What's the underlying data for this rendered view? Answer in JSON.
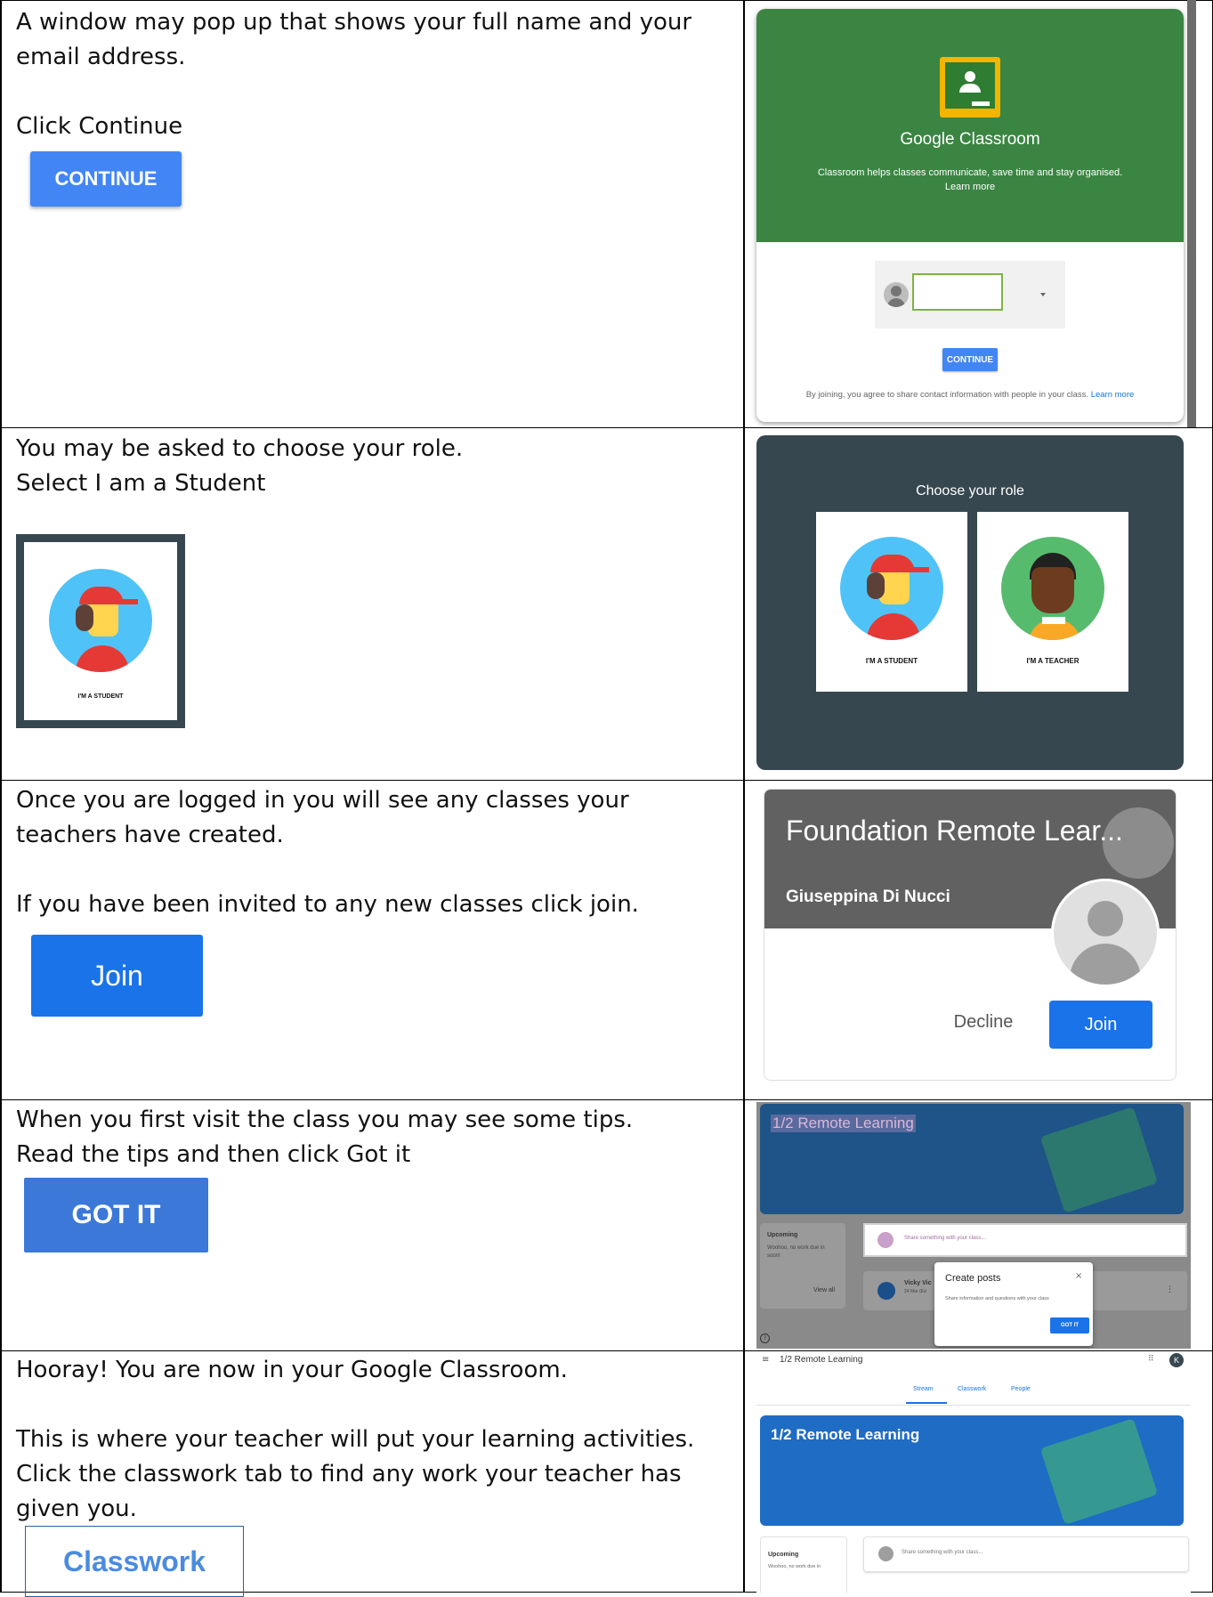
{
  "rows": [
    {
      "lines": [
        "A window may pop up that shows your full name and your email address.",
        "",
        "Click Continue"
      ],
      "button_label": "CONTINUE",
      "shot": {
        "app_name": "Google Classroom",
        "tagline": "Classroom helps classes communicate, save time and stay organised. Learn more",
        "button_label": "CONTINUE",
        "footer": "By joining, you agree to share contact information with people in your class.",
        "footer_link": "Learn more"
      }
    },
    {
      "lines": [
        "You may be asked to choose your role.",
        "Select I am a Student"
      ],
      "card_label": "I'M A STUDENT",
      "shot": {
        "heading": "Choose your role",
        "student_label": "I'M A STUDENT",
        "teacher_label": "I'M A TEACHER"
      }
    },
    {
      "lines": [
        "Once you are logged in you will see any classes your teachers have created.",
        "",
        "If you have been invited to any new classes click join."
      ],
      "button_label": "Join",
      "shot": {
        "class_title": "Foundation Remote Lear...",
        "teacher": "Giuseppina Di Nucci",
        "decline": "Decline",
        "join": "Join"
      }
    },
    {
      "lines": [
        "When you first visit the class you may see some tips.",
        "Read the tips and then click Got it"
      ],
      "button_label": "GOT IT",
      "shot": {
        "banner_title": "1/2 Remote Learning",
        "upcoming": "Upcoming",
        "upcoming_note": "Woohoo, no work due in soon!",
        "view_all": "View all",
        "share_placeholder": "Share something with your class...",
        "poster": "Vicky Vic",
        "poster_date": "24 Mar (Ed",
        "popup_title": "Create posts",
        "popup_text": "Share information and questions with your class",
        "popup_button": "GOT IT"
      }
    },
    {
      "lines": [
        "Hooray!  You are now in your Google Classroom.",
        "",
        "This is where your teacher will put your learning activities. Click the classwork tab to find any work your teacher has given you."
      ],
      "button_label": "Classwork",
      "shot": {
        "topbar_title": "1/2 Remote Learning",
        "tabs": [
          "Stream",
          "Classwork",
          "People"
        ],
        "avatar_letter": "K",
        "banner_title": "1/2 Remote Learning",
        "upcoming": "Upcoming",
        "upcoming_note": "Woohoo, no work due in",
        "share_placeholder": "Share something with your class..."
      }
    }
  ],
  "colors": {
    "classroom_green": "#3b8543",
    "google_blue": "#4285f4",
    "join_blue": "#1a73e8",
    "role_dark": "#37474f",
    "banner_blue": "#1e66b4"
  }
}
